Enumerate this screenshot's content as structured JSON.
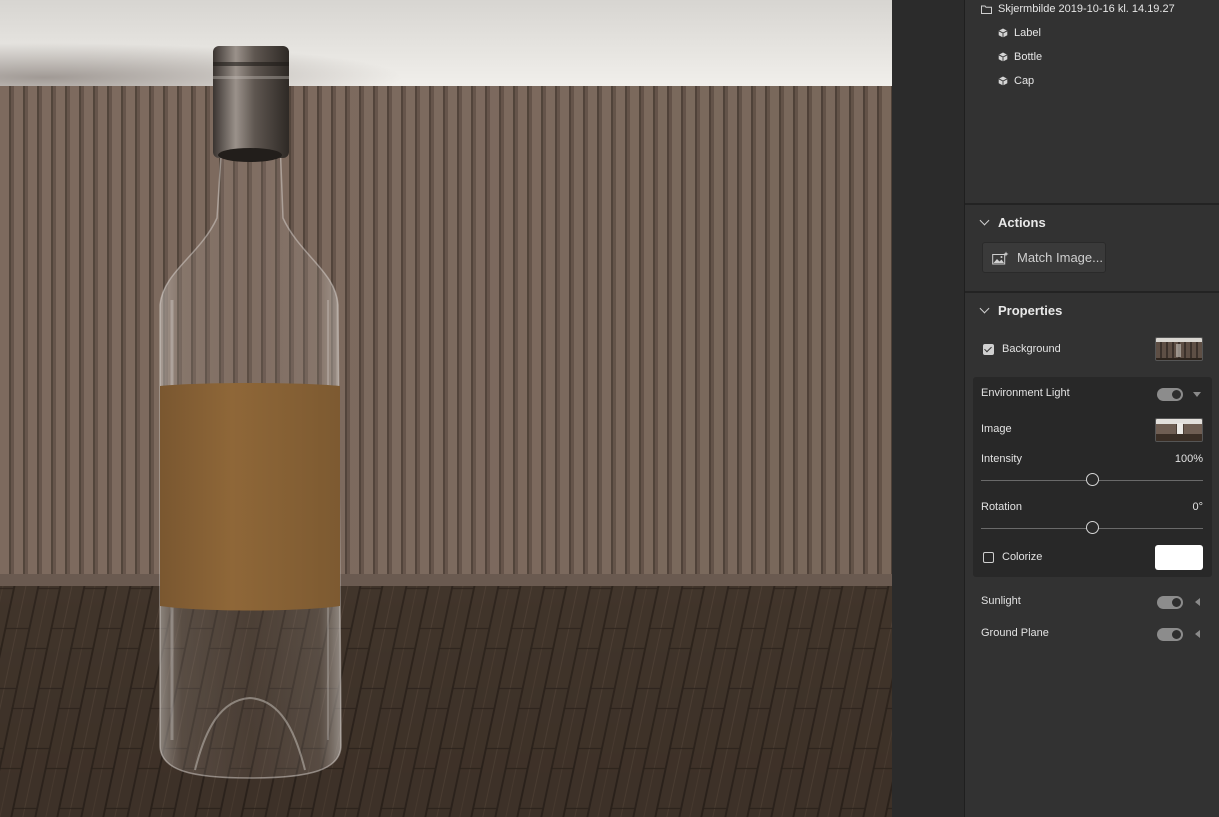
{
  "scene": {
    "root": {
      "label": "Skjermbilde 2019-10-16 kl. 14.19.27",
      "icon": "folder-icon"
    },
    "items": [
      {
        "label": "Label",
        "icon": "cube-icon"
      },
      {
        "label": "Bottle",
        "icon": "cube-icon"
      },
      {
        "label": "Cap",
        "icon": "cube-icon"
      }
    ]
  },
  "actions": {
    "title": "Actions",
    "match_image": {
      "label": "Match Image...",
      "icon": "image-sparkle-icon"
    }
  },
  "properties": {
    "title": "Properties",
    "background": {
      "label": "Background",
      "checked": true
    },
    "environment_light": {
      "label": "Environment Light",
      "enabled": true,
      "image_label": "Image",
      "intensity_label": "Intensity",
      "intensity_value": "100%",
      "intensity_fraction": 0.5,
      "rotation_label": "Rotation",
      "rotation_value": "0°",
      "rotation_fraction": 0.5,
      "colorize_label": "Colorize",
      "colorize_checked": false,
      "colorize_color": "#ffffff"
    },
    "sunlight": {
      "label": "Sunlight",
      "enabled": true
    },
    "ground_plane": {
      "label": "Ground Plane",
      "enabled": true
    }
  },
  "colors": {
    "panel_bg": "#323232",
    "group_bg": "#282828",
    "wall": "#6e5d52",
    "floor": "#3d3026",
    "label": "#8c6434"
  }
}
